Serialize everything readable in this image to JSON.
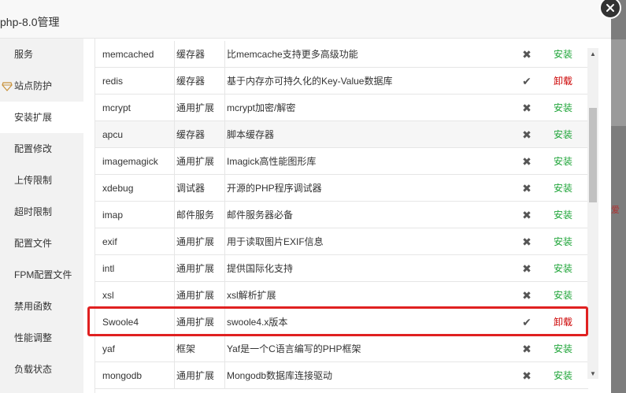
{
  "dialog": {
    "title": "php-8.0管理"
  },
  "sidebar": {
    "items": [
      {
        "label": "服务"
      },
      {
        "label": "站点防护"
      },
      {
        "label": "安装扩展"
      },
      {
        "label": "配置修改"
      },
      {
        "label": "上传限制"
      },
      {
        "label": "超时限制"
      },
      {
        "label": "配置文件"
      },
      {
        "label": "FPM配置文件"
      },
      {
        "label": "禁用函数"
      },
      {
        "label": "性能调整"
      },
      {
        "label": "负载状态"
      }
    ],
    "active_index": 2
  },
  "extensions": [
    {
      "name": "memcached",
      "type": "缓存器",
      "desc": "比memcache支持更多高级功能",
      "installed": false,
      "action": "安装"
    },
    {
      "name": "redis",
      "type": "缓存器",
      "desc": "基于内存亦可持久化的Key-Value数据库",
      "installed": true,
      "action": "卸载"
    },
    {
      "name": "mcrypt",
      "type": "通用扩展",
      "desc": "mcrypt加密/解密",
      "installed": false,
      "action": "安装"
    },
    {
      "name": "apcu",
      "type": "缓存器",
      "desc": "脚本缓存器",
      "installed": false,
      "action": "安装"
    },
    {
      "name": "imagemagick",
      "type": "通用扩展",
      "desc": "Imagick高性能图形库",
      "installed": false,
      "action": "安装"
    },
    {
      "name": "xdebug",
      "type": "调试器",
      "desc": "开源的PHP程序调试器",
      "installed": false,
      "action": "安装"
    },
    {
      "name": "imap",
      "type": "邮件服务",
      "desc": "邮件服务器必备",
      "installed": false,
      "action": "安装"
    },
    {
      "name": "exif",
      "type": "通用扩展",
      "desc": "用于读取图片EXIF信息",
      "installed": false,
      "action": "安装"
    },
    {
      "name": "intl",
      "type": "通用扩展",
      "desc": "提供国际化支持",
      "installed": false,
      "action": "安装"
    },
    {
      "name": "xsl",
      "type": "通用扩展",
      "desc": "xsl解析扩展",
      "installed": false,
      "action": "安装"
    },
    {
      "name": "Swoole4",
      "type": "通用扩展",
      "desc": "swoole4.x版本",
      "installed": true,
      "action": "卸载"
    },
    {
      "name": "yaf",
      "type": "框架",
      "desc": "Yaf是一个C语言编写的PHP框架",
      "installed": false,
      "action": "安装"
    },
    {
      "name": "mongodb",
      "type": "通用扩展",
      "desc": "Mongodb数据库连接驱动",
      "installed": false,
      "action": "安装"
    }
  ],
  "icons": {
    "installed": "check-icon",
    "not_installed": "cross-icon",
    "close": "close-icon"
  },
  "colors": {
    "install": "#20a53a",
    "uninstall": "#cc0000",
    "highlight": "#e02020"
  },
  "background": {
    "partial_char": "爱"
  }
}
